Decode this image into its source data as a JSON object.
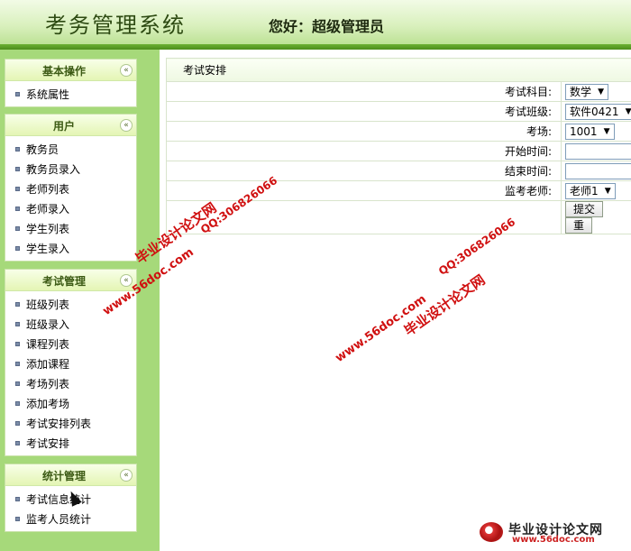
{
  "header": {
    "title": "考务管理系统",
    "greeting": "您好：超级管理员"
  },
  "sidebar": {
    "panels": [
      {
        "title": "基本操作",
        "items": [
          "系统属性"
        ]
      },
      {
        "title": "用户",
        "items": [
          "教务员",
          "教务员录入",
          "老师列表",
          "老师录入",
          "学生列表",
          "学生录入"
        ]
      },
      {
        "title": "考试管理",
        "items": [
          "班级列表",
          "班级录入",
          "课程列表",
          "添加课程",
          "考场列表",
          "添加考场",
          "考试安排列表",
          "考试安排"
        ]
      },
      {
        "title": "统计管理",
        "items": [
          "考试信息统计",
          "监考人员统计"
        ]
      }
    ],
    "collapse_glyph": "«"
  },
  "form": {
    "caption": "考试安排",
    "fields": {
      "subject": {
        "label": "考试科目:",
        "value": "数学"
      },
      "class": {
        "label": "考试班级:",
        "value": "软件0421"
      },
      "room": {
        "label": "考场:",
        "value": "1001"
      },
      "start": {
        "label": "开始时间:",
        "value": ""
      },
      "end": {
        "label": "结束时间:",
        "value": ""
      },
      "teacher": {
        "label": "监考老师:",
        "value": "老师1"
      }
    },
    "submit_label": "提交",
    "reset_label": "重"
  },
  "watermarks": {
    "site": "www.56doc.com",
    "qq": "QQ:306826066",
    "brand": "毕业设计论文网"
  },
  "footer_logo": {
    "main": "毕业设计论文网",
    "sub": "www.56doc.com"
  },
  "colors": {
    "sidebar_bg": "#a6d97a",
    "header_bar": "#5a9e25",
    "watermark": "#d01010"
  }
}
